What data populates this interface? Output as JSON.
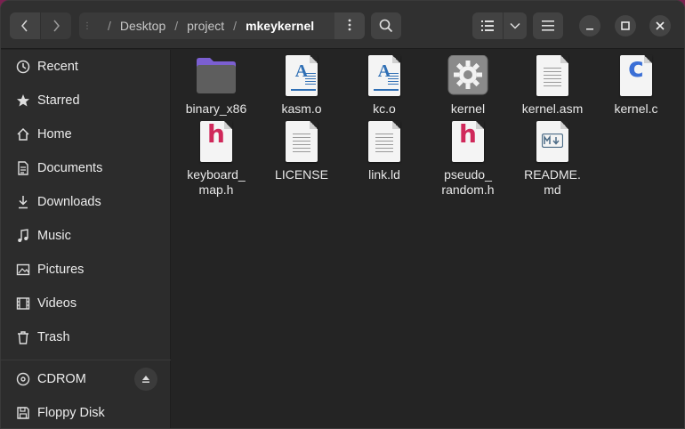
{
  "path": {
    "segments": [
      "Desktop",
      "project"
    ],
    "current": "mkeykernel"
  },
  "sidebar": {
    "items": [
      {
        "label": "Recent",
        "icon": "clock-icon"
      },
      {
        "label": "Starred",
        "icon": "star-icon"
      },
      {
        "label": "Home",
        "icon": "home-icon"
      },
      {
        "label": "Documents",
        "icon": "document-icon"
      },
      {
        "label": "Downloads",
        "icon": "download-icon"
      },
      {
        "label": "Music",
        "icon": "music-icon"
      },
      {
        "label": "Pictures",
        "icon": "picture-icon"
      },
      {
        "label": "Videos",
        "icon": "video-icon"
      },
      {
        "label": "Trash",
        "icon": "trash-icon"
      }
    ],
    "devices": [
      {
        "label": "CDROM",
        "icon": "disc-icon"
      },
      {
        "label": "Floppy Disk",
        "icon": "floppy-icon"
      }
    ]
  },
  "files": [
    {
      "name": "binary_x86",
      "type": "folder"
    },
    {
      "name": "kasm.o",
      "type": "object"
    },
    {
      "name": "kc.o",
      "type": "object"
    },
    {
      "name": "kernel",
      "type": "executable"
    },
    {
      "name": "kernel.asm",
      "type": "text"
    },
    {
      "name": "kernel.c",
      "type": "c-source"
    },
    {
      "name": "keyboard_",
      "name2": "map.h",
      "type": "c-header"
    },
    {
      "name": "LICENSE",
      "type": "text"
    },
    {
      "name": "link.ld",
      "type": "text"
    },
    {
      "name": "pseudo_",
      "name2": "random.h",
      "type": "c-header"
    },
    {
      "name": "README.",
      "name2": "md",
      "type": "markdown"
    }
  ],
  "colors": {
    "accent_folder": "#7b5fd1",
    "header_red": "#d0285a",
    "c_blue": "#3b6fd6"
  }
}
